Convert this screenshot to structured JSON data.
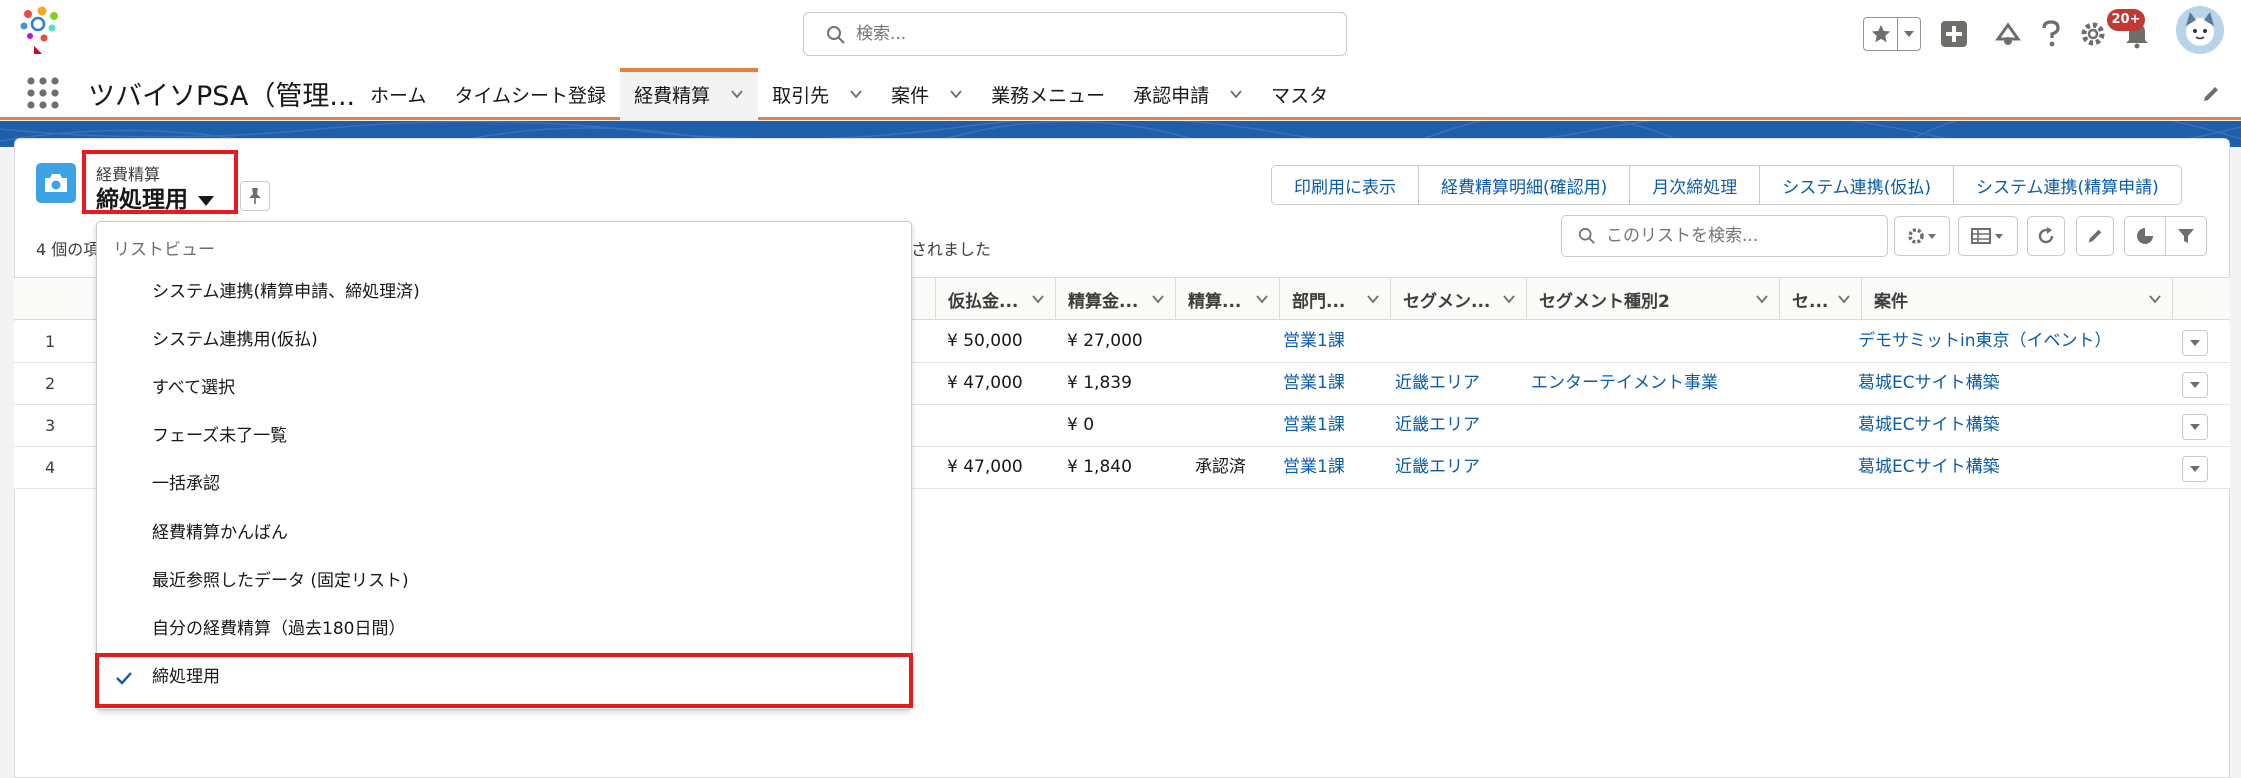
{
  "header": {
    "search_placeholder": "検索...",
    "notification_count": "20+"
  },
  "nav": {
    "app_name": "ツバイソPSA（管理...",
    "items": [
      {
        "label": "ホーム",
        "has_menu": false
      },
      {
        "label": "タイムシート登録",
        "has_menu": false
      },
      {
        "label": "経費精算",
        "has_menu": true,
        "active": true
      },
      {
        "label": "取引先",
        "has_menu": true
      },
      {
        "label": "案件",
        "has_menu": true
      },
      {
        "label": "業務メニュー",
        "has_menu": false
      },
      {
        "label": "承認申請",
        "has_menu": true
      },
      {
        "label": "マスタ",
        "has_menu": false
      }
    ]
  },
  "list_view": {
    "object_label": "経費精算",
    "title": "締処理用",
    "status_left": "4 個の項",
    "status_right": "されました",
    "search_placeholder": "このリストを検索...",
    "actions": [
      "印刷用に表示",
      "経費精算明細(確認用)",
      "月次締処理",
      "システム連携(仮払)",
      "システム連携(精算申請)"
    ]
  },
  "table": {
    "columns": [
      "仮払金...",
      "精算金...",
      "精算...",
      "部門...",
      "セグメン...",
      "セグメント種別2",
      "セ...",
      "案件"
    ],
    "rows": [
      {
        "num": "1",
        "advance": "¥ 50,000",
        "settle": "¥ 27,000",
        "status": "",
        "dept": "営業1課",
        "segment": "",
        "segment2": "",
        "seg3": "",
        "project": "デモサミットin東京（イベント）"
      },
      {
        "num": "2",
        "advance": "¥ 47,000",
        "settle": "¥ 1,839",
        "status": "",
        "dept": "営業1課",
        "segment": "近畿エリア",
        "segment2": "エンターテイメント事業",
        "seg3": "",
        "project": "葛城ECサイト構築"
      },
      {
        "num": "3",
        "advance": "",
        "settle": "¥ 0",
        "status": "",
        "dept": "営業1課",
        "segment": "近畿エリア",
        "segment2": "",
        "seg3": "",
        "project": "葛城ECサイト構築"
      },
      {
        "num": "4",
        "advance": "¥ 47,000",
        "settle": "¥ 1,840",
        "status": "承認済",
        "dept": "営業1課",
        "segment": "近畿エリア",
        "segment2": "",
        "seg3": "",
        "project": "葛城ECサイト構築"
      }
    ]
  },
  "dropdown": {
    "header": "リストビュー",
    "items": [
      {
        "label": "システム連携(精算申請、締処理済)",
        "selected": false
      },
      {
        "label": "システム連携用(仮払)",
        "selected": false
      },
      {
        "label": "すべて選択",
        "selected": false
      },
      {
        "label": "フェーズ未了一覧",
        "selected": false
      },
      {
        "label": "一括承認",
        "selected": false
      },
      {
        "label": "経費精算かんばん",
        "selected": false
      },
      {
        "label": "最近参照したデータ (固定リスト)",
        "selected": false
      },
      {
        "label": "自分の経費精算（過去180日間）",
        "selected": false
      },
      {
        "label": "締処理用",
        "selected": true
      }
    ]
  },
  "colors": {
    "accent_orange": "#e8803c",
    "link_blue": "#0b5cab",
    "brand_band": "#1f5ea8",
    "object_icon": "#3ba3e5",
    "highlight_red": "#e51c1c",
    "badge_red": "#c23934"
  },
  "icons": [
    "app-logo",
    "search-icon",
    "star-icon",
    "plus-icon",
    "cloud-icon",
    "help-icon",
    "gear-icon",
    "bell-icon",
    "avatar",
    "app-launcher-icon",
    "pencil-icon",
    "camera-icon",
    "pin-icon",
    "refresh-icon",
    "chart-icon",
    "filter-icon",
    "check-icon"
  ]
}
